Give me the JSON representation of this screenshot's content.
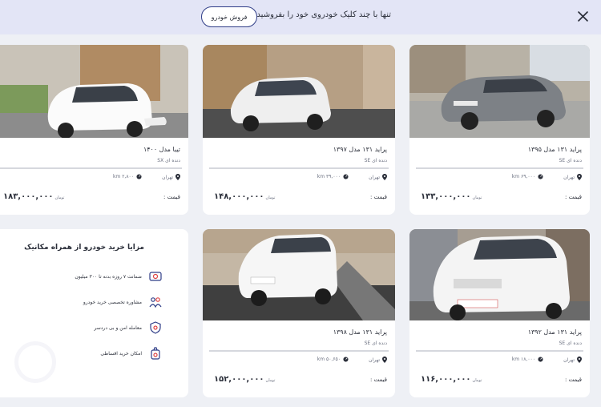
{
  "topbar": {
    "promo_text": "تنها با چند کلیک خودروی خود را بفروشید",
    "sell_button_label": "فروش خودرو",
    "close_icon": "close-icon"
  },
  "price_label": "قیمت :",
  "listings": [
    {
      "title": "پراید ۱۳۱ مدل ۱۳۹۵",
      "trim": "دنده ای SE",
      "city": "تهران",
      "mileage": "۶۹,۰۰۰ km",
      "price": "۱۳۳,۰۰۰,۰۰۰",
      "currency": "تومان",
      "car_color": "#8a8e93"
    },
    {
      "title": "پراید ۱۳۱ مدل ۱۳۹۷",
      "trim": "دنده ای SE",
      "city": "تهران",
      "mileage": "۳۹,۰۰۰ km",
      "price": "۱۴۸,۰۰۰,۰۰۰",
      "currency": "تومان",
      "car_color": "#f2f2f2"
    },
    {
      "title": "تیبا مدل ۱۴۰۰",
      "trim": "دنده ای SX",
      "city": "تهران",
      "mileage": "۲,۸۰۰ km",
      "price": "۱۸۳,۰۰۰,۰۰۰",
      "currency": "تومان",
      "car_color": "#f5f5f5"
    },
    {
      "title": "پراید ۱۳۱ مدل ۱۳۹۲",
      "trim": "دنده ای SE",
      "city": "تهران",
      "mileage": "۱۸,۰۰۰ km",
      "price": "۱۱۶,۰۰۰,۰۰۰",
      "currency": "تومان",
      "car_color": "#f5f5f5"
    },
    {
      "title": "پراید ۱۳۱ مدل ۱۳۹۸",
      "trim": "دنده ای SE",
      "city": "تهران",
      "mileage": "۵۰,۶۵۰ km",
      "price": "۱۵۲,۰۰۰,۰۰۰",
      "currency": "تومان",
      "car_color": "#f5f5f5"
    }
  ],
  "benefits": {
    "title": "مزایا خرید خودرو از همراه مکانیک",
    "items": [
      {
        "label": "ضمانت ۷ روزه بدنه تا ۳۰۰ میلیون",
        "icon": "warranty-icon"
      },
      {
        "label": "مشاوره تخصصی خرید خودرو",
        "icon": "consulting-icon"
      },
      {
        "label": "معامله امن و بی دردسر",
        "icon": "shield-icon"
      },
      {
        "label": "امکان خرید اقساطی",
        "icon": "installment-icon"
      }
    ]
  },
  "colors": {
    "accent": "#2f3d87",
    "topbar": "#e3e5f6",
    "background": "#eef0f5"
  }
}
